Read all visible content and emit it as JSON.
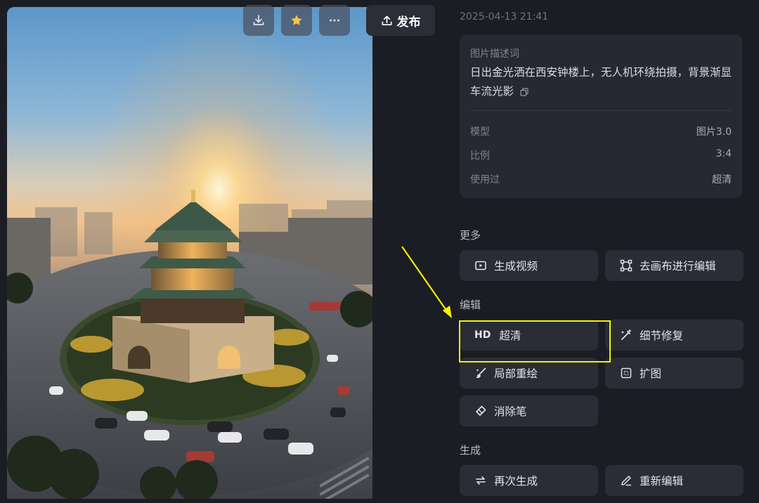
{
  "toolbar": {
    "download_icon": "download-icon",
    "favorite_icon": "star-icon",
    "more_icon": "more-icon",
    "publish_label": "发布"
  },
  "image": {
    "alt": "日出金光洒在西安钟楼上，无人机环绕拍摄，背景渐显车流光影"
  },
  "meta": {
    "timestamp": "2025-04-13 21:41",
    "description_label": "图片描述词",
    "description": "日出金光洒在西安钟楼上，无人机环绕拍摄，背景渐显车流光影",
    "rows": [
      {
        "key": "模型",
        "value": "图片3.0"
      },
      {
        "key": "比例",
        "value": "3:4"
      },
      {
        "key": "使用过",
        "value": "超清"
      }
    ]
  },
  "sections": {
    "more": {
      "title": "更多",
      "actions": [
        {
          "label": "生成视频",
          "icon": "video-icon"
        },
        {
          "label": "去画布进行编辑",
          "icon": "canvas-icon"
        }
      ]
    },
    "edit": {
      "title": "编辑",
      "actions": [
        {
          "label": "超清",
          "icon": "hd-icon",
          "icon_text": "HD"
        },
        {
          "label": "细节修复",
          "icon": "magic-wand-icon"
        },
        {
          "label": "局部重绘",
          "icon": "brush-icon"
        },
        {
          "label": "扩图",
          "icon": "expand-icon"
        },
        {
          "label": "消除笔",
          "icon": "eraser-icon"
        }
      ]
    },
    "generate": {
      "title": "生成",
      "actions": [
        {
          "label": "再次生成",
          "icon": "regenerate-icon"
        },
        {
          "label": "重新编辑",
          "icon": "pencil-icon"
        }
      ]
    }
  },
  "annotation": {
    "highlight_color": "#f6f000",
    "arrow_color": "#f6f000"
  },
  "colors": {
    "background": "#1b1d24",
    "card": "#262932",
    "button": "#2a2d36"
  }
}
